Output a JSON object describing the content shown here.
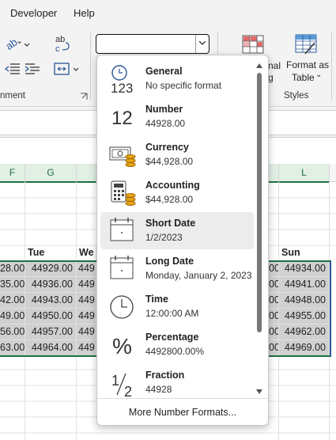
{
  "menubar": {
    "developer": "Developer",
    "help": "Help"
  },
  "ribbon": {
    "alignment_group_label": "nment",
    "styles_group_label": "Styles",
    "conditional_fragment_1": "nal",
    "conditional_fragment_2": "g",
    "format_as_table_line1": "Format as",
    "format_as_table_line2": "Table",
    "format_chevron": "⌄",
    "dropdown_chevron": "⌄",
    "wrap_icon_text": "ab\nc"
  },
  "number_format_box": {
    "value": ""
  },
  "columns": {
    "F": "F",
    "G": "G",
    "L": "L"
  },
  "grid": {
    "headers": {
      "tue": "Tue",
      "wed": "We",
      "sun": "Sun"
    },
    "rows": [
      {
        "f": "28.00",
        "g": "44929.00",
        "h": "449",
        "k": "00",
        "l": "44934.00"
      },
      {
        "f": "35.00",
        "g": "44936.00",
        "h": "449",
        "k": "00",
        "l": "44941.00"
      },
      {
        "f": "42.00",
        "g": "44943.00",
        "h": "449",
        "k": "00",
        "l": "44948.00"
      },
      {
        "f": "49.00",
        "g": "44950.00",
        "h": "449",
        "k": "00",
        "l": "44955.00"
      },
      {
        "f": "56.00",
        "g": "44957.00",
        "h": "449",
        "k": "00",
        "l": "44962.00"
      },
      {
        "f": "63.00",
        "g": "44964.00",
        "h": "449",
        "k": "00",
        "l": "44969.00"
      }
    ]
  },
  "dropdown": {
    "items": [
      {
        "name": "General",
        "example": "No specific format",
        "icon_text": "123"
      },
      {
        "name": "Number",
        "example": "44928.00",
        "icon_text": "12"
      },
      {
        "name": "Currency",
        "example": "$44,928.00"
      },
      {
        "name": "Accounting",
        "example": " $44,928.00"
      },
      {
        "name": "Short Date",
        "example": "1/2/2023"
      },
      {
        "name": "Long Date",
        "example": "Monday, January 2, 2023"
      },
      {
        "name": "Time",
        "example": "12:00:00 AM"
      },
      {
        "name": "Percentage",
        "example": "4492800.00%",
        "icon_text": "%"
      },
      {
        "name": "Fraction",
        "example": "44928",
        "icon_text": "½"
      }
    ],
    "more_label": "More Number Formats..."
  }
}
